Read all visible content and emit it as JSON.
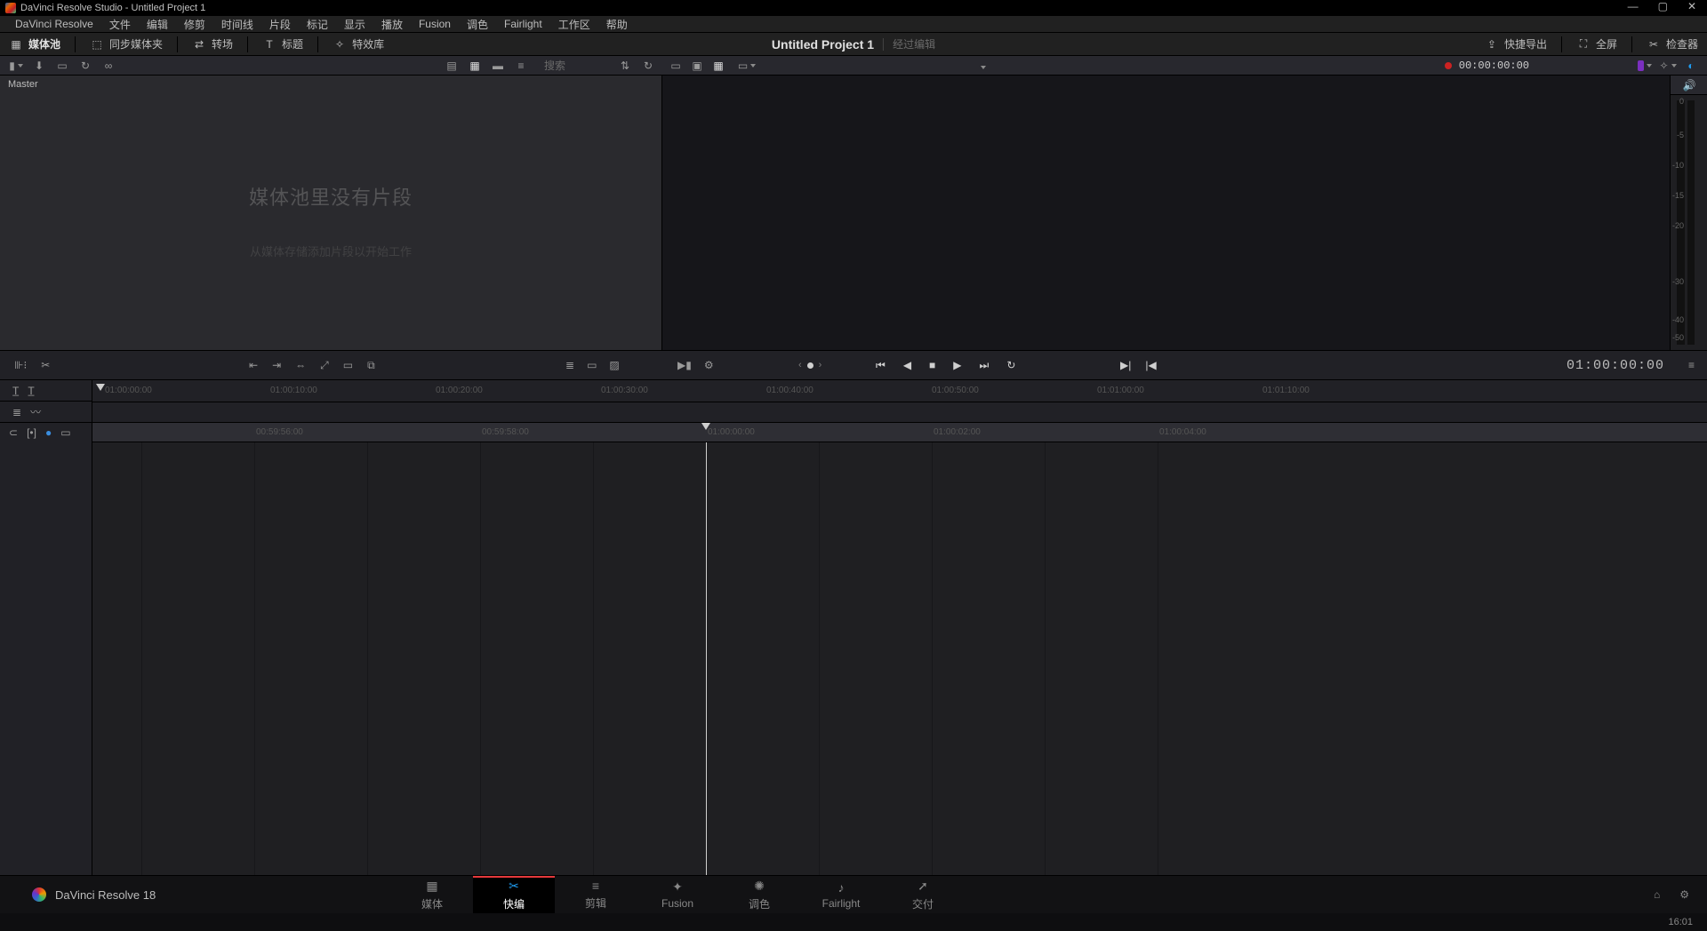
{
  "titlebar": {
    "text": "DaVinci Resolve Studio - Untitled Project 1"
  },
  "menu": [
    "DaVinci Resolve",
    "文件",
    "编辑",
    "修剪",
    "时间线",
    "片段",
    "标记",
    "显示",
    "播放",
    "Fusion",
    "调色",
    "Fairlight",
    "工作区",
    "帮助"
  ],
  "workspace": {
    "media_pool": "媒体池",
    "sync_bin": "同步媒体夹",
    "transitions": "转场",
    "titles": "标题",
    "effects": "特效库",
    "project_title": "Untitled Project 1",
    "project_status": "经过编辑",
    "quick_export": "快捷导出",
    "fullscreen": "全屏",
    "inspector": "检查器"
  },
  "sub_toolbar": {
    "search_placeholder": "搜索",
    "viewer_tc": "00:00:00:00"
  },
  "media_panel": {
    "header": "Master",
    "empty_title": "媒体池里没有片段",
    "empty_subtitle": "从媒体存储添加片段以开始工作"
  },
  "meter_marks": [
    "0",
    "-5",
    "-10",
    "-15",
    "-20",
    "-30",
    "-40",
    "-50"
  ],
  "upper_ruler_labels": [
    "01:00:00:00",
    "01:00:10:00",
    "01:00:20:00",
    "01:00:30:00",
    "01:00:40:00",
    "01:00:50:00",
    "01:01:00:00",
    "01:01:10:00"
  ],
  "tl_ruler_labels": [
    "00:59:56:00",
    "00:59:58:00",
    "01:00:00:00",
    "01:00:02:00",
    "01:00:04:00"
  ],
  "mid_bar_tc": "01:00:00:00",
  "page_tabs": {
    "brand": "DaVinci Resolve 18",
    "tabs": [
      {
        "label": "媒体",
        "icon": "▦"
      },
      {
        "label": "快编",
        "icon": "✂",
        "active": true
      },
      {
        "label": "剪辑",
        "icon": "≡"
      },
      {
        "label": "Fusion",
        "icon": "✦"
      },
      {
        "label": "调色",
        "icon": "✺"
      },
      {
        "label": "Fairlight",
        "icon": "♪"
      },
      {
        "label": "交付",
        "icon": "➚"
      }
    ]
  },
  "status_time": "16:01"
}
